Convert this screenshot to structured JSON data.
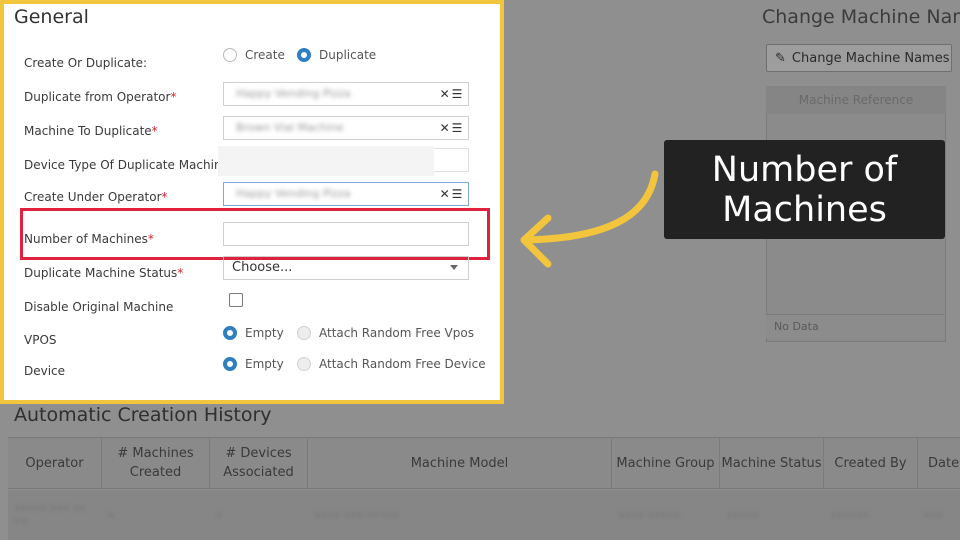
{
  "background": {
    "right_title": "Change Machine Nam",
    "change_names_button": "Change Machine Names",
    "grid_header": "Machine Reference",
    "grid_empty": "No Data",
    "history_title": "Automatic Creation History",
    "history_columns": [
      "Operator",
      "# Machines Created",
      "# Devices Associated",
      "Machine Model",
      "Machine Group",
      "Machine Status",
      "Created By",
      "Date"
    ],
    "history_row": [
      "••••• ••• •• ••",
      "•",
      "•",
      "•••• ••• •••••",
      "•••• •••••",
      "•••••",
      "••••••",
      "•••"
    ]
  },
  "form": {
    "title": "General",
    "create_or_duplicate": {
      "label": "Create Or Duplicate:",
      "options": [
        "Create",
        "Duplicate"
      ],
      "selected": "Duplicate"
    },
    "duplicate_from_operator": {
      "label": "Duplicate from Operator",
      "value": "Happy Vending Pizza"
    },
    "machine_to_duplicate": {
      "label": "Machine To Duplicate",
      "value": "Brown Vial Machine"
    },
    "device_type": {
      "label": "Device Type Of Duplicate Machine"
    },
    "create_under_operator": {
      "label": "Create Under Operator",
      "value": "Happy Vending Pizza"
    },
    "number_of_machines": {
      "label": "Number of Machines",
      "value": ""
    },
    "duplicate_machine_status": {
      "label": "Duplicate Machine Status",
      "value": "Choose..."
    },
    "disable_original": {
      "label": "Disable Original Machine",
      "checked": false
    },
    "vpos": {
      "label": "VPOS",
      "options": [
        "Empty",
        "Attach Random Free Vpos"
      ],
      "selected": "Empty"
    },
    "device": {
      "label": "Device",
      "options": [
        "Empty",
        "Attach Random Free Device"
      ],
      "selected": "Empty"
    },
    "required_mark": "*"
  },
  "callout": {
    "text": "Number of Machines"
  },
  "colors": {
    "highlight_border": "#f2c53d",
    "focus_box": "#e0213e",
    "arrow": "#f2c53d",
    "radio_on": "#2f7fc1"
  }
}
